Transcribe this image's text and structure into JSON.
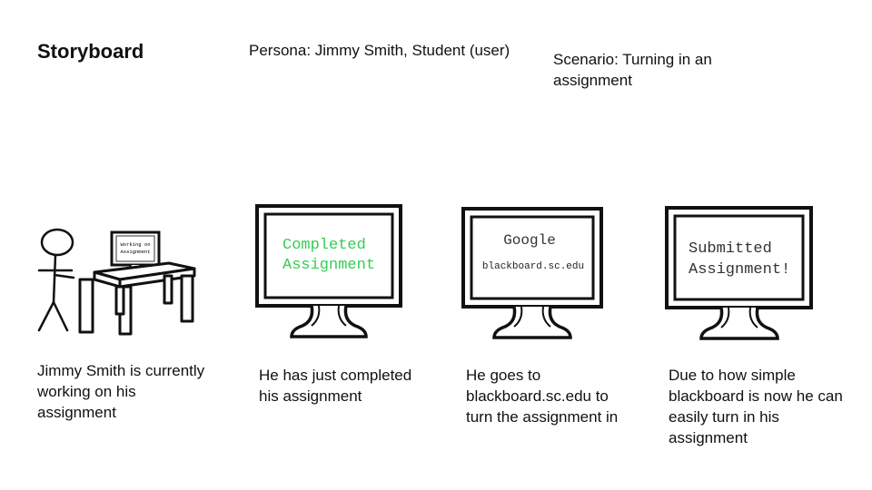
{
  "header": {
    "title": "Storyboard",
    "persona": "Persona: Jimmy Smith, Student (user)",
    "scenario": "Scenario: Turning in an assignment"
  },
  "panels": [
    {
      "screen_text": [
        "Working on",
        "Assignment"
      ],
      "caption": "Jimmy Smith is currently working on his assignment"
    },
    {
      "screen_text": [
        "Completed",
        "Assignment"
      ],
      "screen_color": "#33cc55",
      "caption": "He has just completed his assignment"
    },
    {
      "screen_text": [
        "Google",
        "blackboard.sc.edu"
      ],
      "caption": "He goes to blackboard.sc.edu to turn the assignment in"
    },
    {
      "screen_text": [
        "Submitted",
        "Assignment!"
      ],
      "caption": "Due to how simple blackboard is now he can easily turn in his assignment"
    }
  ]
}
